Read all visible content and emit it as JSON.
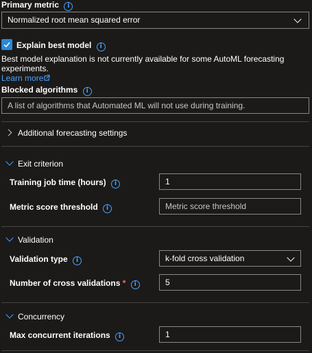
{
  "primary_metric": {
    "label": "Primary metric",
    "selected": "Normalized root mean squared error"
  },
  "explain_best_model": {
    "label": "Explain best model",
    "checked": true,
    "note": "Best model explanation is not currently available for some AutoML forecasting experiments.",
    "learn_more": "Learn more"
  },
  "blocked_algorithms": {
    "label": "Blocked algorithms",
    "placeholder": "A list of algorithms that Automated ML will not use during training."
  },
  "additional_forecasting": {
    "label": "Additional forecasting settings"
  },
  "exit_criterion": {
    "title": "Exit criterion",
    "training_time_label": "Training job time (hours)",
    "training_time_value": "1",
    "metric_threshold_label": "Metric score threshold",
    "metric_threshold_placeholder": "Metric score threshold"
  },
  "validation": {
    "title": "Validation",
    "type_label": "Validation type",
    "type_value": "k-fold cross validation",
    "cross_validations_label": "Number of cross validations",
    "required_mark": "*",
    "cross_validations_value": "5"
  },
  "concurrency": {
    "title": "Concurrency",
    "max_iterations_label": "Max concurrent iterations",
    "max_iterations_value": "1"
  },
  "colors": {
    "background": "#1b1a19",
    "accent": "#2b88d8",
    "link": "#4aa3ff",
    "border": "#8a8886"
  },
  "icons": [
    "info-icon",
    "chevron-down-icon",
    "chevron-right-icon",
    "checkmark-icon",
    "open-in-new-icon"
  ]
}
